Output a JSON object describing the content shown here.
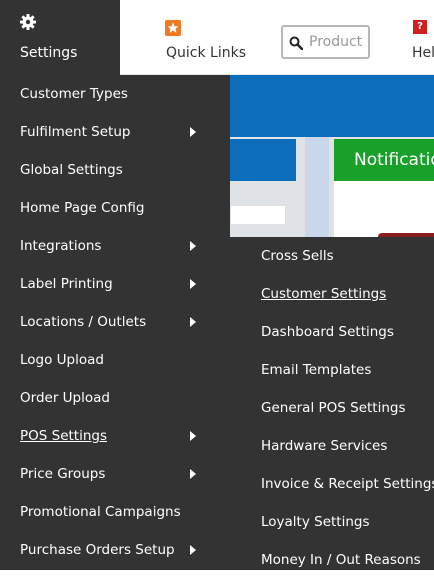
{
  "topbar": {
    "settings_label": "Settings",
    "settings_icon": "gear-icon",
    "quick_links_label": "Quick Links",
    "quick_links_icon": "star-icon",
    "search_placeholder": "Product",
    "search_icon": "search-icon",
    "help_label": "Help",
    "help_icon_glyph": "?"
  },
  "background": {
    "notification_label": "Notifications"
  },
  "menu": {
    "items": [
      {
        "label": "Customer Types"
      },
      {
        "label": "Fulfilment Setup"
      },
      {
        "label": "Global Settings"
      },
      {
        "label": "Home Page Config"
      },
      {
        "label": "Integrations"
      },
      {
        "label": "Label Printing"
      },
      {
        "label": "Locations / Outlets"
      },
      {
        "label": "Logo Upload"
      },
      {
        "label": "Order Upload"
      },
      {
        "label": "POS Settings"
      },
      {
        "label": "Price Groups"
      },
      {
        "label": "Promotional Campaigns"
      },
      {
        "label": "Purchase Orders Setup"
      }
    ]
  },
  "submenu": {
    "items": [
      {
        "label": "Cross Sells"
      },
      {
        "label": "Customer Settings"
      },
      {
        "label": "Dashboard Settings"
      },
      {
        "label": "Email Templates"
      },
      {
        "label": "General POS Settings"
      },
      {
        "label": "Hardware Services"
      },
      {
        "label": "Invoice & Receipt Settings"
      },
      {
        "label": "Loyalty Settings"
      },
      {
        "label": "Money In / Out Reasons"
      }
    ]
  },
  "colors": {
    "menu_bg": "#333333",
    "accent_blue": "#0a6ebd",
    "notification_green": "#18a02a",
    "quick_links_orange": "#f07a21",
    "help_red": "#d01f1f"
  }
}
